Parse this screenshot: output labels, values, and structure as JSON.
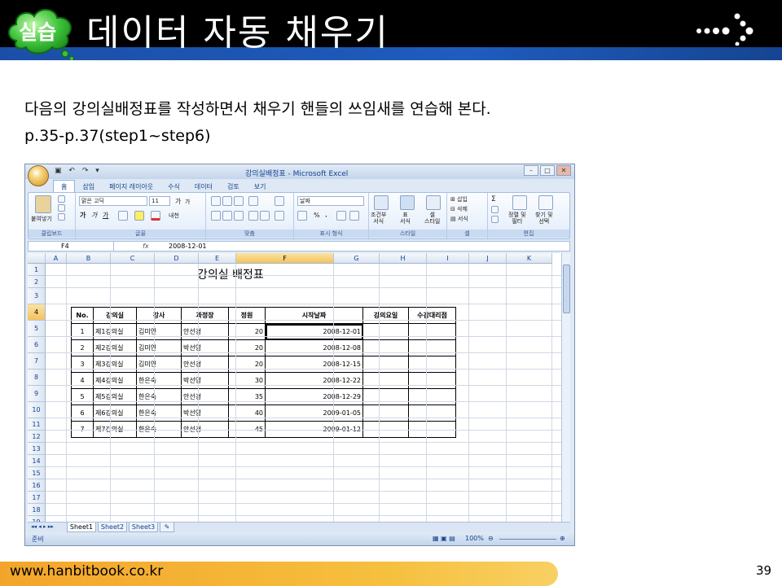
{
  "slide": {
    "badge": "실습",
    "title": "데이터 자동 채우기",
    "desc_line1": "다음의 강의실배정표를 작성하면서 채우기 핸들의 쓰임새를 연습해 본다.",
    "desc_line2": "p.35-p.37(step1~step6)",
    "footer_url": "www.hanbitbook.co.kr",
    "page_number": "39"
  },
  "excel": {
    "window_title": "강의실배정표 - Microsoft Excel",
    "tabs": [
      "홈",
      "삽입",
      "페이지 레이아웃",
      "수식",
      "데이터",
      "검토",
      "보기"
    ],
    "active_tab": "홈",
    "ribbon": {
      "clipboard": {
        "label": "클립보드",
        "paste": "붙여넣기"
      },
      "font": {
        "label": "글꼴",
        "font_name": "맑은 고딕",
        "font_size": "11",
        "bold": "가",
        "italic": "가",
        "underline": "가",
        "grow": "가",
        "shrink": "가",
        "phonetic": "내천"
      },
      "align": {
        "label": "맞춤"
      },
      "number": {
        "label": "표시 형식",
        "format": "날짜",
        "percent": "%",
        "comma": ","
      },
      "style": {
        "label": "스타일",
        "conditional": "조건부\n서식",
        "table": "표\n서식",
        "cell": "셀\n스타일"
      },
      "cells": {
        "label": "셀",
        "insert": "삽입",
        "delete": "삭제",
        "format": "서식"
      },
      "edit": {
        "label": "편집",
        "sort": "정렬 및\n필터",
        "find": "찾기 및\n선택"
      }
    },
    "name_box": "F4",
    "fx": "fx",
    "formula_value": "2008-12-01",
    "columns": [
      "A",
      "B",
      "C",
      "D",
      "E",
      "F",
      "G",
      "H",
      "I",
      "J",
      "K"
    ],
    "rows": [
      "1",
      "2",
      "3",
      "4",
      "5",
      "6",
      "7",
      "8",
      "9",
      "10",
      "11",
      "12",
      "13",
      "14",
      "15",
      "16",
      "17",
      "18",
      "19"
    ],
    "sheet_title": "강의실 배정표",
    "table_headers": [
      "No.",
      "강의실",
      "강사",
      "과정장",
      "정원",
      "시작날짜",
      "강의요일",
      "수강대리점"
    ],
    "table_rows": [
      [
        "1",
        "제1강의실",
        "김미연",
        "안선경",
        "20",
        "2008-12-01",
        "",
        ""
      ],
      [
        "2",
        "제2강의실",
        "김미연",
        "박선영",
        "20",
        "2008-12-08",
        "",
        ""
      ],
      [
        "3",
        "제3강의실",
        "김미연",
        "안선경",
        "20",
        "2008-12-15",
        "",
        ""
      ],
      [
        "4",
        "제4강의실",
        "한은숙",
        "박선영",
        "30",
        "2008-12-22",
        "",
        ""
      ],
      [
        "5",
        "제5강의실",
        "한은숙",
        "안선경",
        "35",
        "2008-12-29",
        "",
        ""
      ],
      [
        "6",
        "제6강의실",
        "한은숙",
        "박선영",
        "40",
        "2009-01-05",
        "",
        ""
      ],
      [
        "7",
        "제7강의실",
        "한은숙",
        "안선경",
        "45",
        "2009-01-12",
        "",
        ""
      ]
    ],
    "sheets": [
      "Sheet1",
      "Sheet2",
      "Sheet3"
    ],
    "active_sheet": "Sheet1",
    "status_left": "준비",
    "zoom": "100%"
  }
}
